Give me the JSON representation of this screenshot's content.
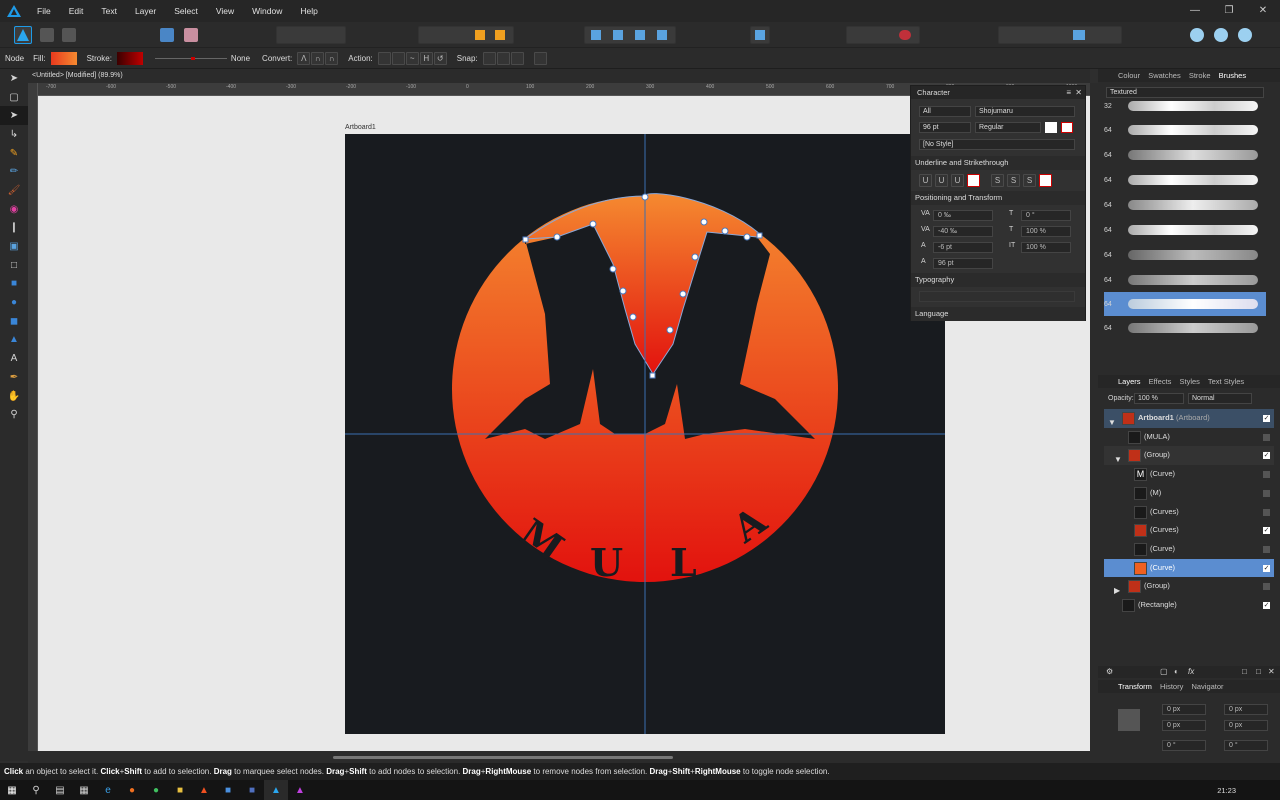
{
  "menu": {
    "items": [
      "File",
      "Edit",
      "Text",
      "Layer",
      "Select",
      "View",
      "Window",
      "Help"
    ]
  },
  "context": {
    "tool_name": "Node",
    "fill_label": "Fill:",
    "stroke_label": "Stroke:",
    "stroke_value": "None",
    "convert_label": "Convert:",
    "action_label": "Action:",
    "snap_label": "Snap:",
    "fill_color": "#f05a28",
    "stroke_color": "#8b0000"
  },
  "document": {
    "title": "<Untitled> [Modified] (89.9%)",
    "artboard_label": "Artboard1",
    "ruler_h": [
      "-700",
      "-600",
      "-500",
      "-400",
      "-300",
      "-200",
      "-100",
      "0",
      "100",
      "200",
      "300",
      "400",
      "500",
      "600",
      "700",
      "800",
      "900",
      "1000",
      "1100",
      "1200",
      "1300",
      "1400"
    ],
    "logo_letters": [
      "M",
      "U",
      "L",
      "A"
    ]
  },
  "character": {
    "title": "Character",
    "scope": "All",
    "font": "Shojumaru",
    "size": "96 pt",
    "style": "Regular",
    "text_style": "[No Style]",
    "underline_section": "Underline and Strikethrough",
    "positioning_section": "Positioning and Transform",
    "tracking": "0 ‰",
    "kerning": "-40 ‰",
    "baseline": "-6 pt",
    "leading": "96 pt",
    "skew": "0 °",
    "scale_v": "100 %",
    "scale_h": "100 %",
    "typography_section": "Typography",
    "language_section": "Language"
  },
  "brushes": {
    "tabs": [
      "Colour",
      "Swatches",
      "Stroke",
      "Brushes"
    ],
    "category": "Textured",
    "sizes": [
      "32",
      "64",
      "64",
      "64",
      "64",
      "64",
      "64",
      "64",
      "64",
      "64"
    ]
  },
  "layers": {
    "tabs": [
      "Layers",
      "Effects",
      "Styles",
      "Text Styles"
    ],
    "opacity_label": "Opacity:",
    "opacity": "100 %",
    "blend_mode": "Normal",
    "rows": [
      {
        "name": "Artboard1",
        "suffix": " (Artboard)"
      },
      {
        "name": "(MULA)"
      },
      {
        "name": "(Group)"
      },
      {
        "name": "(Curve)"
      },
      {
        "name": "(M)"
      },
      {
        "name": "(Curves)"
      },
      {
        "name": "(Curves)"
      },
      {
        "name": "(Curve)"
      },
      {
        "name": "(Curve)"
      },
      {
        "name": "(Group)"
      },
      {
        "name": "(Rectangle)"
      }
    ]
  },
  "transform": {
    "tabs": [
      "Transform",
      "History",
      "Navigator"
    ],
    "x": "0 px",
    "y": "0 px",
    "w": "0 px",
    "h": "0 px",
    "r": "0 °",
    "s": "0 °"
  },
  "status": {
    "parts": [
      {
        "t": "Click",
        "b": true
      },
      {
        "t": " an object to select it. "
      },
      {
        "t": "Click",
        "b": true
      },
      {
        "t": "+"
      },
      {
        "t": "Shift",
        "b": true
      },
      {
        "t": " to add to selection. "
      },
      {
        "t": "Drag",
        "b": true
      },
      {
        "t": " to marquee select nodes. "
      },
      {
        "t": "Drag",
        "b": true
      },
      {
        "t": "+"
      },
      {
        "t": "Shift",
        "b": true
      },
      {
        "t": " to add nodes to selection. "
      },
      {
        "t": "Drag",
        "b": true
      },
      {
        "t": "+"
      },
      {
        "t": "RightMouse",
        "b": true
      },
      {
        "t": " to remove nodes from selection. "
      },
      {
        "t": "Drag",
        "b": true
      },
      {
        "t": "+"
      },
      {
        "t": "Shift",
        "b": true
      },
      {
        "t": "+"
      },
      {
        "t": "RightMouse",
        "b": true
      },
      {
        "t": " to toggle node selection."
      }
    ]
  },
  "taskbar": {
    "time": "21:23"
  }
}
